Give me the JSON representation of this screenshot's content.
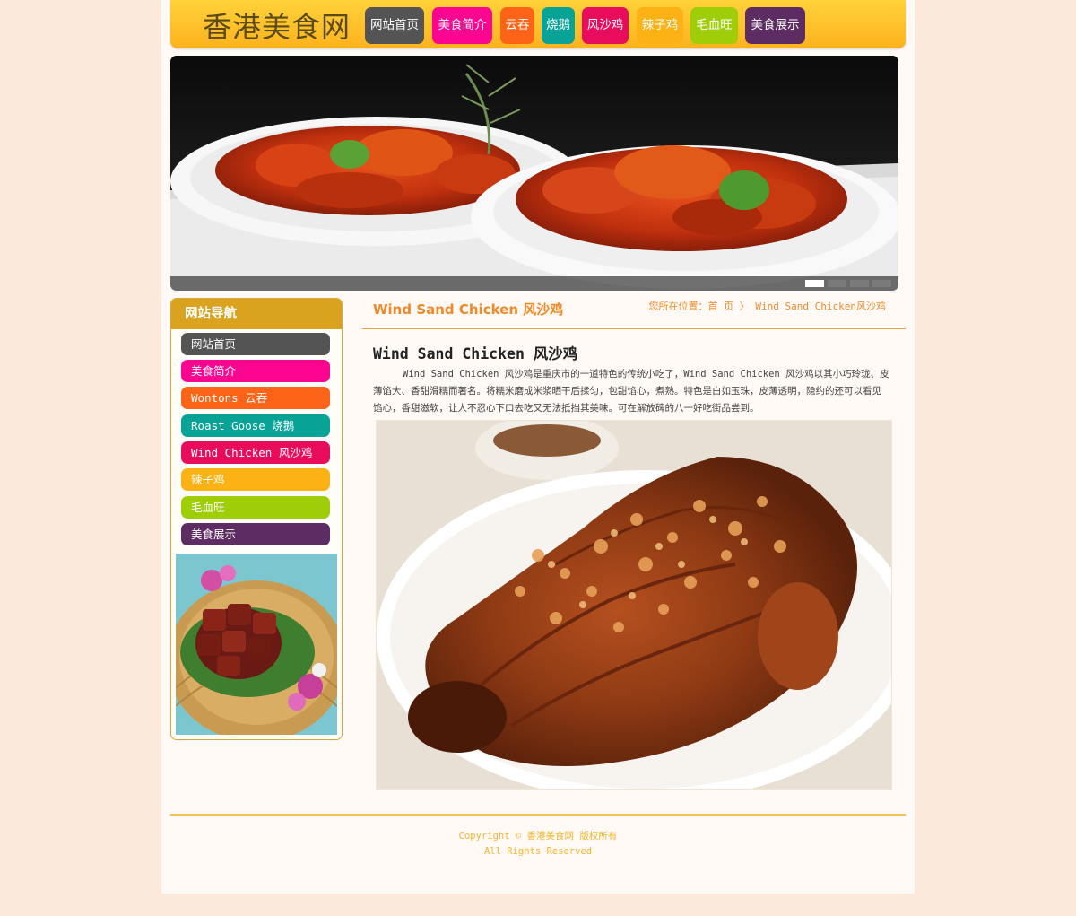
{
  "site": {
    "title": "香港美食网"
  },
  "top_nav": [
    {
      "label": "网站首页",
      "color": "#545454"
    },
    {
      "label": "美食简介",
      "color": "#fb0591"
    },
    {
      "label": "云吞",
      "color": "#fe6418"
    },
    {
      "label": "烧鹅",
      "color": "#07a397"
    },
    {
      "label": "风沙鸡",
      "color": "#ea0c5c"
    },
    {
      "label": "辣子鸡",
      "color": "#fcb215"
    },
    {
      "label": "毛血旺",
      "color": "#9fce08"
    },
    {
      "label": "美食展示",
      "color": "#5d2c62"
    }
  ],
  "banner": {
    "slides": 4,
    "active_slide": 1
  },
  "sidebar": {
    "heading": "网站导航",
    "items": [
      {
        "label": "网站首页",
        "color": "#545454"
      },
      {
        "label": "美食简介",
        "color": "#fb0591"
      },
      {
        "label": "Wontons 云吞",
        "color": "#fe6418"
      },
      {
        "label": "Roast Goose 烧鹅",
        "color": "#07a397"
      },
      {
        "label": "Wind Chicken 风沙鸡",
        "color": "#ea0c5c"
      },
      {
        "label": "辣子鸡",
        "color": "#fcb215"
      },
      {
        "label": "毛血旺",
        "color": "#9fce08"
      },
      {
        "label": "美食展示",
        "color": "#5d2c62"
      }
    ]
  },
  "main": {
    "title": "Wind Sand Chicken 风沙鸡",
    "breadcrumb": {
      "prefix": "您所在位置：",
      "home": "首 页",
      "separator": "〉",
      "current": "Wind Sand Chicken风沙鸡"
    },
    "article_title": "Wind Sand Chicken 风沙鸡",
    "article_body": "Wind Sand Chicken 风沙鸡是重庆市的一道特色的传统小吃了，Wind Sand Chicken 风沙鸡以其小巧玲珑、皮薄馅大、香甜滑糯而著名。将糯米磨成米浆晒干后揉匀，包甜馅心，煮熟。特色是白如玉珠，皮薄透明，隐约的还可以看见馅心，香甜滋软，让人不忍心下口去吃又无法抵挡其美味。可在解放碑的八一好吃街品尝到。"
  },
  "footer": {
    "line1": "Copyright © 香港美食网 版权所有",
    "line2": "All Rights Reserved"
  }
}
